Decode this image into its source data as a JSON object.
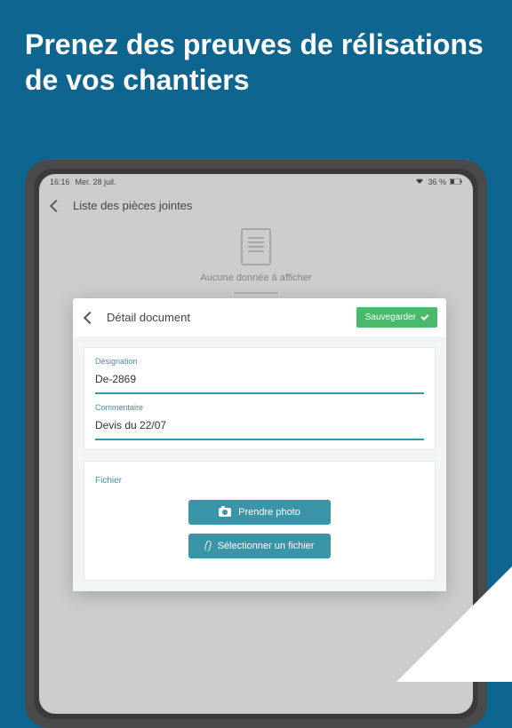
{
  "marketing": {
    "headline": "Prenez des preuves de rélisations de vos chantiers"
  },
  "status_bar": {
    "time": "16:16",
    "date": "Mer. 28 juil.",
    "battery": "36 %"
  },
  "nav": {
    "title": "Liste des pièces jointes"
  },
  "empty_state": {
    "text": "Aucune donnée à afficher"
  },
  "modal": {
    "title": "Détail document",
    "save_label": "Sauvegarder",
    "fields": {
      "designation": {
        "label": "Désignation",
        "value": "De-2869"
      },
      "commentaire": {
        "label": "Commentaire",
        "value": "Devis du 22/07"
      }
    },
    "file_section": {
      "label": "Fichier",
      "take_photo": "Prendre photo",
      "select_file": "Sélectionner un fichier"
    }
  }
}
